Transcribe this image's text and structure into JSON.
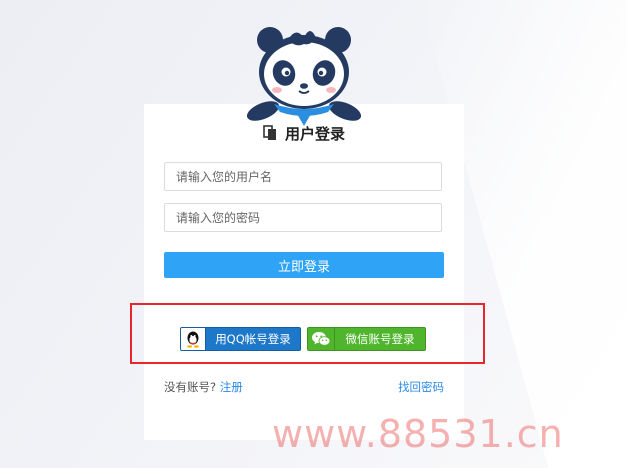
{
  "colors": {
    "primary_button": "#2fa3f5",
    "qq_button": "#1d78c9",
    "wechat_button": "#4fb52c",
    "link": "#2b8be6",
    "highlight_border": "#e8262b",
    "watermark": "#ec7070"
  },
  "header": {
    "title": "用户登录",
    "title_icon": "copy-document-icon",
    "mascot": "panda-mascot"
  },
  "form": {
    "username_placeholder": "请输入您的用户名",
    "password_placeholder": "请输入您的密码",
    "submit_label": "立即登录"
  },
  "social": {
    "qq_label": "用QQ帐号登录",
    "qq_icon": "qq-penguin-icon",
    "wechat_label": "微信账号登录",
    "wechat_icon": "wechat-icon"
  },
  "footer": {
    "no_account_text": "没有账号?",
    "register_link": "注册",
    "forgot_password_link": "找回密码"
  },
  "watermark": "www.88531.cn"
}
